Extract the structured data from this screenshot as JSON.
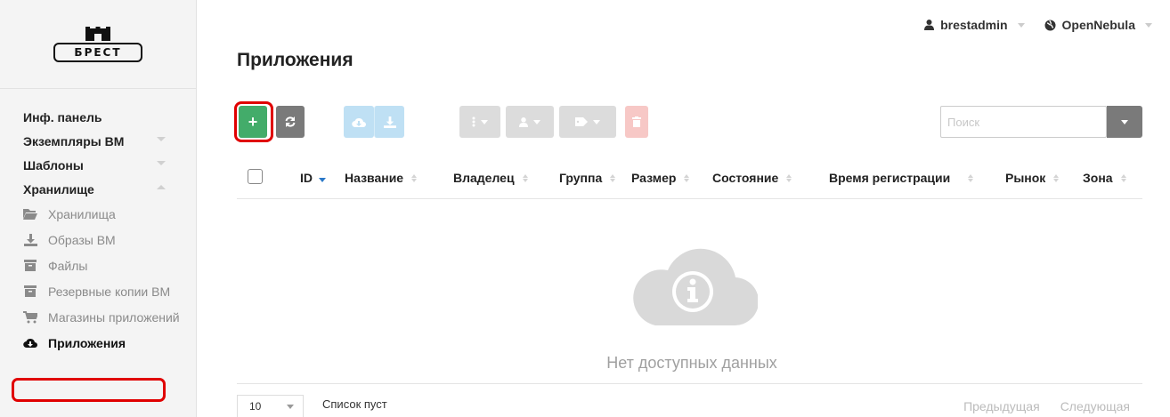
{
  "sidebar": {
    "logo_text": "БРЕСТ",
    "items": [
      {
        "label": "Инф. панель"
      },
      {
        "label": "Экземпляры ВМ"
      },
      {
        "label": "Шаблоны"
      },
      {
        "label": "Хранилище"
      }
    ],
    "storage_items": [
      {
        "label": "Хранилища",
        "icon": "folder-open-icon"
      },
      {
        "label": "Образы ВМ",
        "icon": "download-icon"
      },
      {
        "label": "Файлы",
        "icon": "archive-icon"
      },
      {
        "label": "Резервные копии ВМ",
        "icon": "archive-icon"
      },
      {
        "label": "Магазины приложений",
        "icon": "shopping-cart-icon"
      },
      {
        "label": "Приложения",
        "icon": "cloud-download-icon",
        "active": true
      }
    ]
  },
  "header": {
    "user": "brestadmin",
    "zone": "OpenNebula",
    "page_title": "Приложения"
  },
  "toolbar": {
    "create_label": "+",
    "search_placeholder": "Поиск"
  },
  "table": {
    "columns": [
      "ID",
      "Название",
      "Владелец",
      "Группа",
      "Размер",
      "Состояние",
      "Время регистрации",
      "Рынок",
      "Зона"
    ],
    "sorted_column": "ID",
    "rows": [],
    "empty_message": "Нет доступных данных"
  },
  "footer": {
    "page_size": "10",
    "status": "Список пуст",
    "prev_label": "Предыдущая",
    "next_label": "Следующая"
  },
  "colors": {
    "create_button": "#43ac6a",
    "neutral_button": "#7a7a7a",
    "highlight_outline": "#e00000",
    "sort_active": "#2a78c8"
  }
}
